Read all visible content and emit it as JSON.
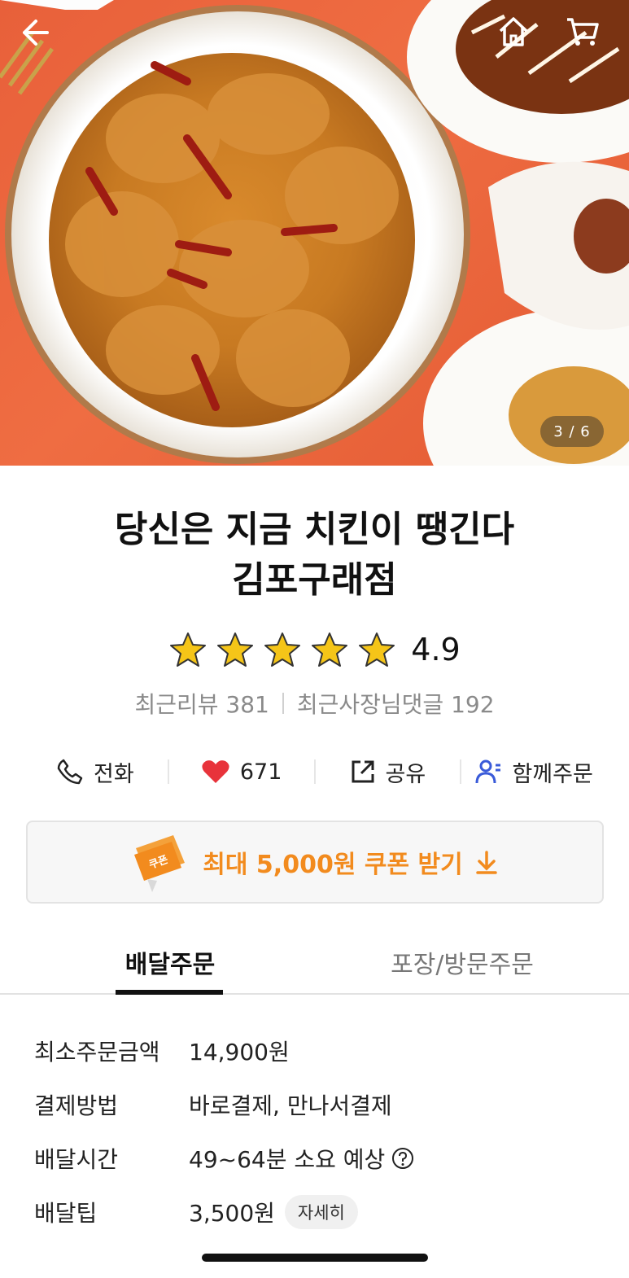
{
  "hero": {
    "page_indicator": "3 / 6",
    "icons": [
      "back-arrow-icon",
      "home-icon",
      "cart-icon"
    ]
  },
  "store": {
    "title_line1": "당신은 지금 치킨이 땡긴다",
    "title_line2": "김포구래점",
    "rating": "4.9",
    "stars": 5,
    "recent_reviews": "최근리뷰 381",
    "owner_replies": "최근사장님댓글 192"
  },
  "actions": {
    "call": "전화",
    "likes": "671",
    "share": "공유",
    "group_order": "함께주문"
  },
  "coupon": {
    "text": "최대 5,000원 쿠폰 받기",
    "badge": "쿠폰"
  },
  "tabs": {
    "delivery": "배달주문",
    "pickup": "포장/방문주문"
  },
  "info": [
    {
      "label": "최소주문금액",
      "value": "14,900원"
    },
    {
      "label": "결제방법",
      "value": "바로결제, 만나서결제"
    },
    {
      "label": "배달시간",
      "value": "49~64분 소요 예상"
    },
    {
      "label": "배달팁",
      "value": "3,500원"
    }
  ],
  "info_detail_button": "자세히",
  "colors": {
    "accent_orange": "#f28b1e",
    "star_yellow": "#f5c518",
    "heart_red": "#e8333b",
    "group_blue": "#3a5bd9"
  }
}
